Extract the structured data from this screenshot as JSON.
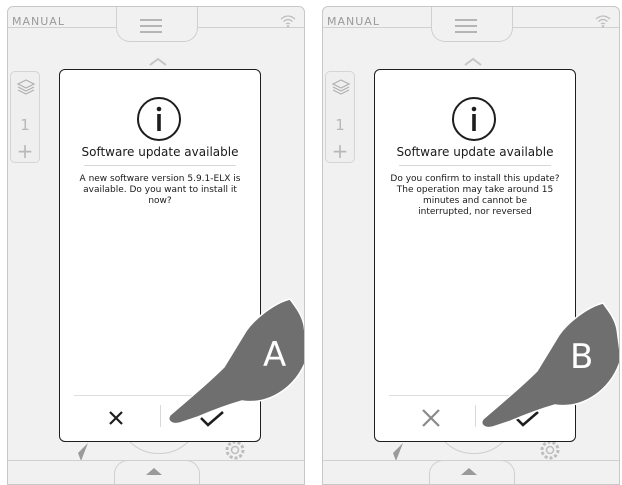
{
  "panels": [
    {
      "id": "A",
      "mode_label": "MANUAL",
      "layer_number": "1",
      "dialog": {
        "title": "Software update available",
        "body": "A new software version 5.9.1-ELX is\navailable. Do you want to install it\nnow?",
        "cancel_icon": "x-icon",
        "confirm_icon": "check-icon",
        "cancel_color": "#1e1e1e"
      },
      "hand_label": "A"
    },
    {
      "id": "B",
      "mode_label": "MANUAL",
      "layer_number": "1",
      "dialog": {
        "title": "Software update available",
        "body": "Do you confirm to install this update?\nThe operation may take around 15\nminutes and cannot be\ninterrupted, nor reversed",
        "cancel_icon": "x-icon",
        "confirm_icon": "check-icon",
        "cancel_color": "#8a8a8a"
      },
      "hand_label": "B"
    }
  ],
  "colors": {
    "device_bg": "#f1f1f1",
    "dialog_border": "#1e1e1e",
    "hand": "#6f6f6f",
    "faded_icon": "#b5b5b5"
  }
}
